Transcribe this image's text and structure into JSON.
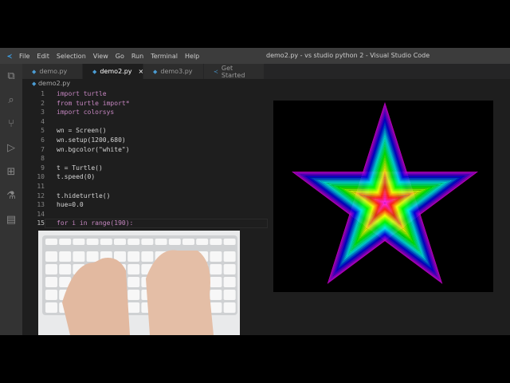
{
  "window": {
    "title": "demo2.py - vs studio python 2 - Visual Studio Code"
  },
  "menu": [
    "File",
    "Edit",
    "Selection",
    "View",
    "Go",
    "Run",
    "Terminal",
    "Help"
  ],
  "tabs": [
    {
      "label": "demo.py",
      "active": false
    },
    {
      "label": "demo2.py",
      "active": true,
      "close": "×"
    },
    {
      "label": "demo3.py",
      "active": false
    },
    {
      "label": "Get Started",
      "active": false
    }
  ],
  "breadcrumb": "demo2.py",
  "code": [
    "import turtle",
    "from turtle import*",
    "import colorsys",
    "",
    "wn = Screen()",
    "wn.setup(1200,680)",
    "wn.bgcolor(\"white\")",
    "",
    "t = Turtle()",
    "t.speed(0)",
    "",
    "t.hideturtle()",
    "hue=0.0",
    "",
    "for i in range(190):"
  ],
  "current_line": 15,
  "colors": {
    "accent": "#007acc",
    "editor_bg": "#1e1e1e"
  }
}
